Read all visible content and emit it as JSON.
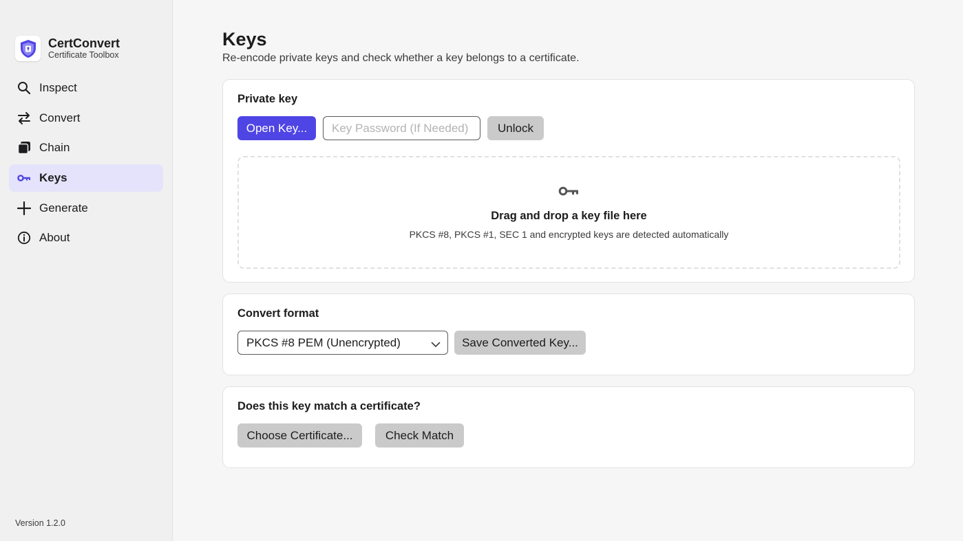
{
  "app": {
    "name": "CertConvert",
    "subtitle": "Certificate Toolbox",
    "version": "Version 1.2.0",
    "accent_color": "#4f45e4"
  },
  "sidebar": {
    "items": [
      {
        "label": "Inspect",
        "icon": "search-icon",
        "active": false
      },
      {
        "label": "Convert",
        "icon": "swap-arrows-icon",
        "active": false
      },
      {
        "label": "Chain",
        "icon": "stack-icon",
        "active": false
      },
      {
        "label": "Keys",
        "icon": "key-icon",
        "active": true
      },
      {
        "label": "Generate",
        "icon": "plus-icon",
        "active": false
      },
      {
        "label": "About",
        "icon": "info-icon",
        "active": false
      }
    ]
  },
  "page": {
    "title": "Keys",
    "subtitle": "Re-encode private keys and check whether a key belongs to a certificate."
  },
  "private_key": {
    "title": "Private key",
    "open_button": "Open Key...",
    "password_placeholder": "Key Password (If Needed)",
    "password_value": "",
    "unlock_button": "Unlock",
    "dropzone": {
      "icon": "key-icon",
      "title": "Drag and drop a key file here",
      "hint": "PKCS #8, PKCS #1, SEC 1 and encrypted keys are detected automatically"
    }
  },
  "convert_format": {
    "title": "Convert format",
    "selected": "PKCS #8 PEM (Unencrypted)",
    "save_button": "Save Converted Key..."
  },
  "match": {
    "title": "Does this key match a certificate?",
    "choose_button": "Choose Certificate...",
    "check_button": "Check Match"
  }
}
